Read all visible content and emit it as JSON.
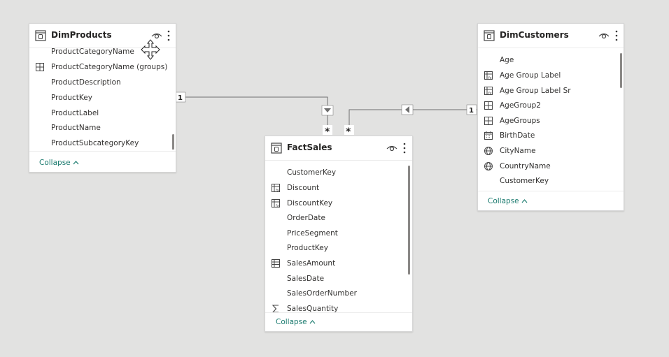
{
  "tables": {
    "dimproducts": {
      "title": "DimProducts",
      "fields": [
        "ProductCategoryName",
        "ProductCategoryName (groups)",
        "ProductDescription",
        "ProductKey",
        "ProductLabel",
        "ProductName",
        "ProductSubcategoryKey"
      ],
      "field_icons": [
        "none",
        "group-icon",
        "none",
        "none",
        "none",
        "none",
        "none"
      ],
      "collapse_label": "Collapse"
    },
    "factsales": {
      "title": "FactSales",
      "fields": [
        "CustomerKey",
        "Discount",
        "DiscountKey",
        "OrderDate",
        "PriceSegment",
        "ProductKey",
        "SalesAmount",
        "SalesDate",
        "SalesOrderNumber",
        "SalesQuantity"
      ],
      "field_icons": [
        "none",
        "calculated-column-icon",
        "calculated-column-icon",
        "none",
        "none",
        "none",
        "measure-table-icon",
        "none",
        "none",
        "sigma-icon"
      ],
      "collapse_label": "Collapse"
    },
    "dimcustomers": {
      "title": "DimCustomers",
      "fields": [
        "Age",
        "Age Group Label",
        "Age Group Label Sr",
        "AgeGroup2",
        "AgeGroups",
        "BirthDate",
        "CityName",
        "CountryName",
        "CustomerKey"
      ],
      "field_icons": [
        "none",
        "calculated-column-icon",
        "calculated-column-icon",
        "group-icon",
        "group-icon",
        "calendar-icon",
        "globe-icon",
        "globe-icon",
        "none"
      ],
      "collapse_label": "Collapse"
    }
  },
  "relationships": {
    "products_to_sales": {
      "from_cardinality": "1",
      "to_cardinality": "*",
      "filter_direction": "down"
    },
    "customers_to_sales": {
      "from_cardinality": "1",
      "to_cardinality": "*",
      "filter_direction": "left"
    }
  },
  "colors": {
    "canvas": "#e2e2e1",
    "card": "#ffffff",
    "accent_link": "#1a7a6e",
    "line": "#6e6e6e"
  }
}
